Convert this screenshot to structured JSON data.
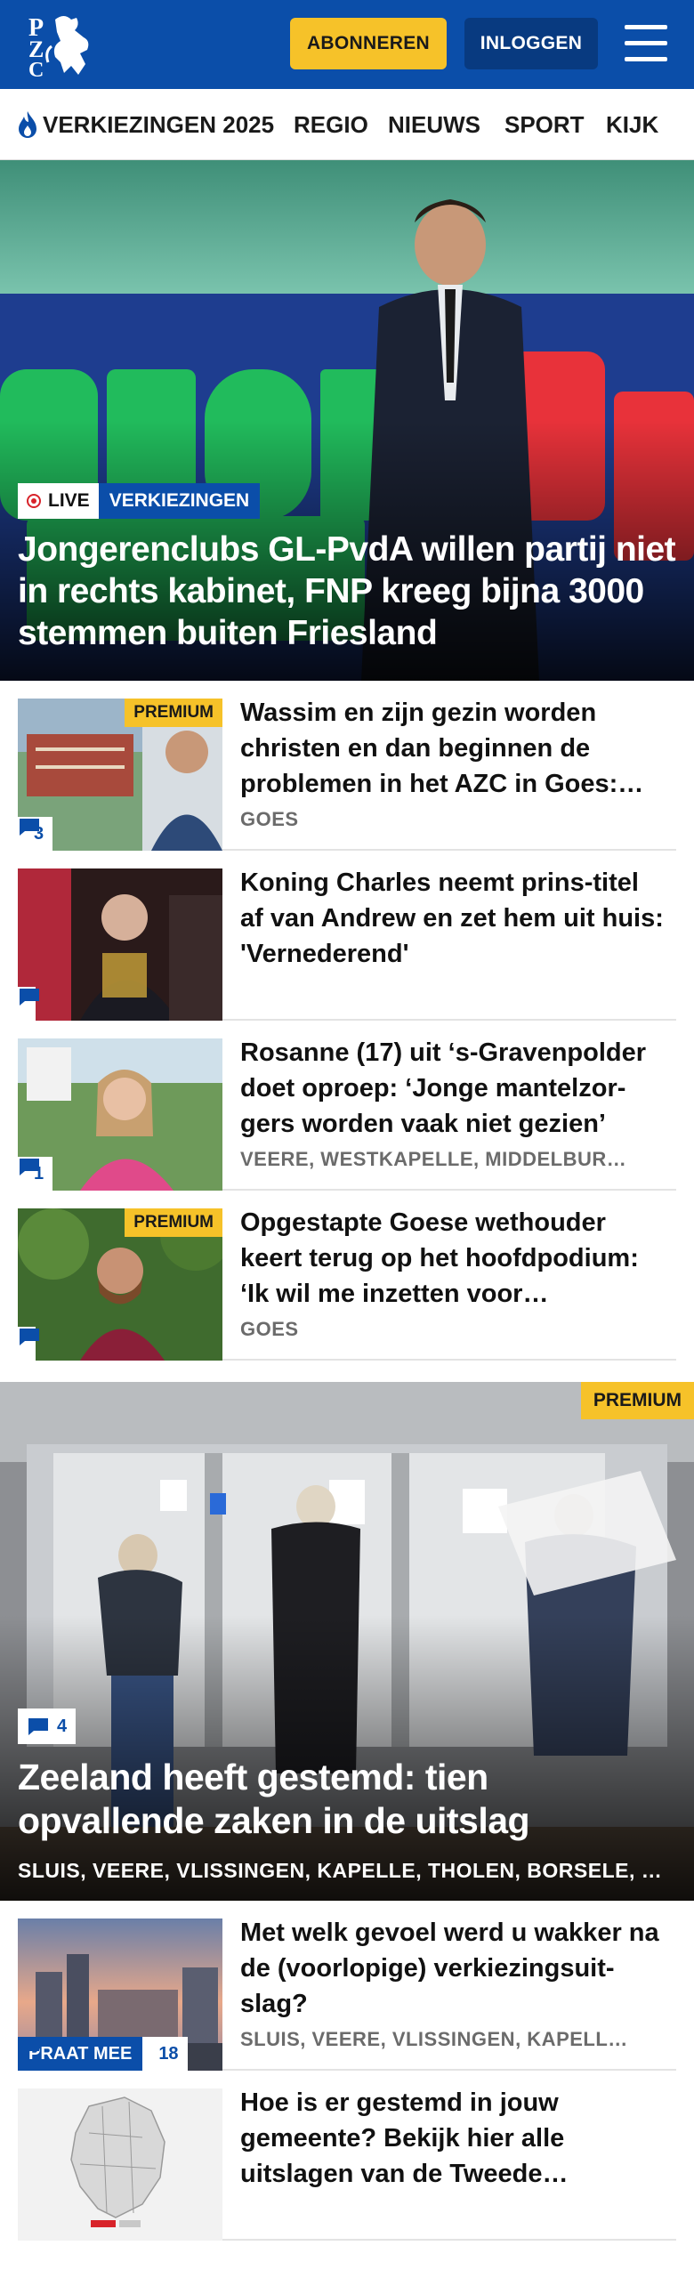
{
  "header": {
    "logo_text": "PZC",
    "subscribe_label": "ABONNEREN",
    "login_label": "INLOGGEN"
  },
  "nav": {
    "items": [
      {
        "label": "VERKIEZINGEN 2025",
        "icon": "flame-icon"
      },
      {
        "label": "REGIO"
      },
      {
        "label": "NIEUWS"
      },
      {
        "label": "SPORT"
      },
      {
        "label": "KIJK"
      }
    ]
  },
  "hero": {
    "live_label": "LIVE",
    "tag_label": "VERKIEZINGEN",
    "title": "Jongerenclubs GL-PvdA willen partij niet in rechts kabinet, FNP kreeg bijna 3000 stemmen buiten Friesland",
    "backdrop_text": "GROEN LINKS PvdA"
  },
  "articles": [
    {
      "title": "Wassim en zijn gezin worden christen en dan beginnen de problemen in het AZC in Goes:…",
      "location": "GOES",
      "premium": "PREMIUM",
      "comments": "3"
    },
    {
      "title": "Koning Charles neemt prins-titel af van Andrew en zet hem uit huis: 'Vernederend'",
      "location": "",
      "premium": "",
      "comments": ""
    },
    {
      "title": "Rosanne (17) uit ‘s-Gravenpolder doet oproep: ‘Jonge mantelzor-gers worden vaak niet gezien’",
      "location": "VEERE, WESTKAPELLE, MIDDELBUR…",
      "premium": "",
      "comments": "1"
    },
    {
      "title": "Opgestapte Goese wethouder keert terug op het hoofdpodium: ‘Ik wil me inzetten voor…",
      "location": "GOES",
      "premium": "PREMIUM",
      "comments": ""
    }
  ],
  "feature": {
    "premium": "PREMIUM",
    "comments": "4",
    "title": "Zeeland heeft gestemd: tien opvallende zaken in de uitslag",
    "location": "SLUIS, VEERE, VLISSINGEN, KAPELLE, THOLEN, BORSELE, …"
  },
  "articles2": [
    {
      "title": "Met welk gevoel werd u wakker na de (voorlopige) verkiezingsuit-slag?",
      "location": "SLUIS, VEERE, VLISSINGEN, KAPELL…",
      "praat_label": "PRAAT MEE",
      "comments": "18"
    },
    {
      "title": "Hoe is er gestemd in jouw gemeente? Bekijk hier alle uitslagen van de Tweede…",
      "location": ""
    }
  ],
  "colors": {
    "brand_blue": "#0b4ea9",
    "dark_blue": "#083a80",
    "accent_yellow": "#f6c229",
    "live_red": "#d8232a"
  }
}
